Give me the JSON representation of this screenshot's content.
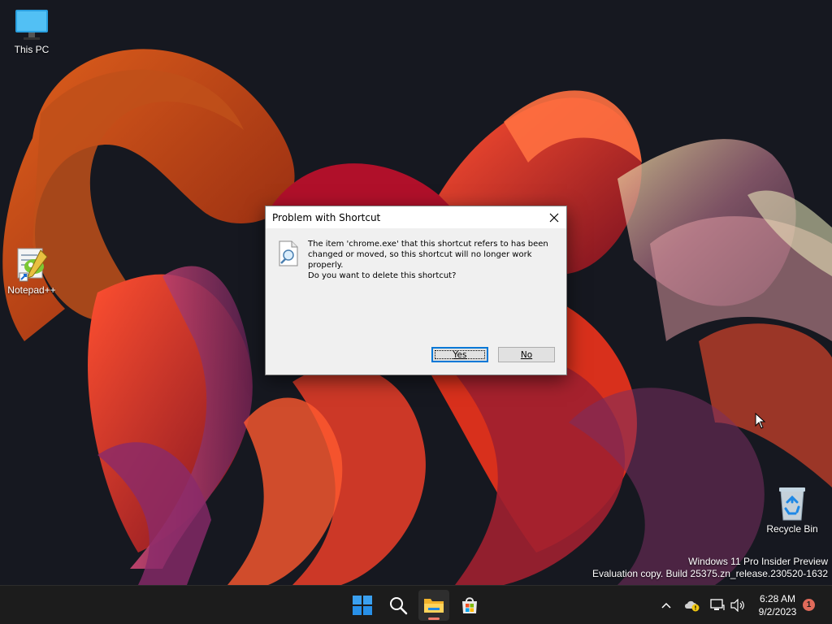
{
  "desktop": {
    "icons": [
      {
        "label": "This PC",
        "icon": "computer-monitor-icon"
      },
      {
        "label": "Notepad++",
        "icon": "notepad-plus-plus-icon"
      },
      {
        "label": "Recycle Bin",
        "icon": "recycle-bin-icon"
      }
    ],
    "watermark": {
      "line1": "Windows 11 Pro Insider Preview",
      "line2": "Evaluation copy. Build 25375.zn_release.230520-1632"
    }
  },
  "dialog": {
    "title": "Problem with Shortcut",
    "message": "The item 'chrome.exe' that this shortcut refers to has been changed or moved, so this shortcut will no longer work properly.",
    "question": "Do you want to delete this shortcut?",
    "yes_label": "Yes",
    "no_label": "No",
    "icon": "document-magnifier-icon"
  },
  "taskbar": {
    "items": [
      {
        "name": "start",
        "icon": "windows-start-icon"
      },
      {
        "name": "search",
        "icon": "search-icon"
      },
      {
        "name": "file-explorer",
        "icon": "folder-icon",
        "active": true
      },
      {
        "name": "microsoft-store",
        "icon": "store-icon"
      }
    ],
    "tray": {
      "time": "6:28 AM",
      "date": "9/2/2023",
      "notification_count": "1"
    }
  },
  "colors": {
    "accent": "#0078d7",
    "taskbar_bg": "#1c1c1c",
    "notification_badge": "#e06a5a"
  }
}
